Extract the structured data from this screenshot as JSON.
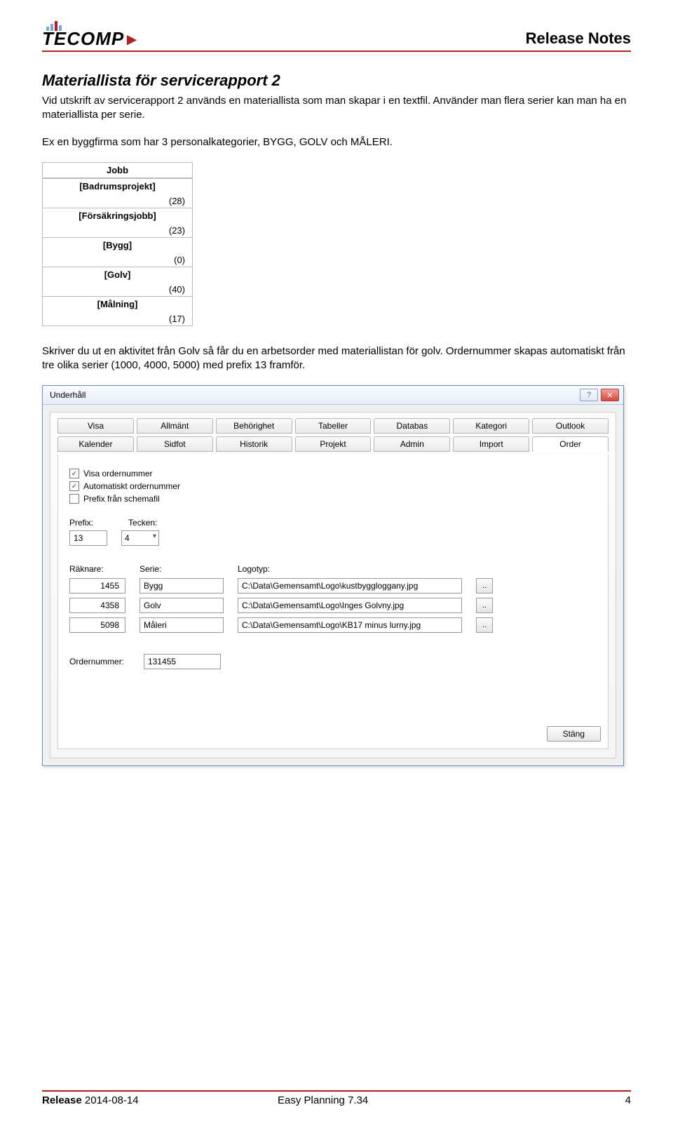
{
  "header": {
    "logo_text": "TECOMP",
    "doc_title": "Release Notes"
  },
  "section_title": "Materiallista för servicerapport 2",
  "para1": "Vid utskrift av servicerapport 2 används en materiallista som man skapar i en textfil. Använder man flera serier kan man ha en materiallista per serie.",
  "para2": "Ex en byggfirma som har 3 personalkategorier, BYGG, GOLV och MÅLERI.",
  "jobb": {
    "header": "Jobb",
    "rows": [
      {
        "label": "[Badrumsprojekt]",
        "count": "(28)"
      },
      {
        "label": "[Försäkringsjobb]",
        "count": "(23)"
      },
      {
        "label": "[Bygg]",
        "count": "(0)"
      },
      {
        "label": "[Golv]",
        "count": "(40)"
      },
      {
        "label": "[Målning]",
        "count": "(17)"
      }
    ]
  },
  "para3": "Skriver du ut en aktivitet från Golv så får du en arbetsorder med materiallistan för golv. Ordernummer skapas automatiskt från tre olika serier (1000, 4000, 5000) med prefix 13 framför.",
  "dialog": {
    "title": "Underhåll",
    "help_glyph": "?",
    "close_glyph": "✕",
    "tabs_top": [
      "Visa",
      "Allmänt",
      "Behörighet",
      "Tabeller",
      "Databas",
      "Kategori",
      "Outlook"
    ],
    "tabs_bottom": [
      "Kalender",
      "Sidfot",
      "Historik",
      "Projekt",
      "Admin",
      "Import",
      "Order"
    ],
    "active_tab": "Order",
    "checks": [
      {
        "label": "Visa ordernummer",
        "checked": true
      },
      {
        "label": "Automatiskt ordernummer",
        "checked": true
      },
      {
        "label": "Prefix från schemafil",
        "checked": false
      }
    ],
    "prefix_label": "Prefix:",
    "tecken_label": "Tecken:",
    "prefix_value": "13",
    "tecken_value": "4",
    "series_headers": {
      "c1": "Räknare:",
      "c2": "Serie:",
      "c3": "Logotyp:"
    },
    "series": [
      {
        "raknare": "1455",
        "serie": "Bygg",
        "logo": "C:\\Data\\Gemensamt\\Logo\\kustbyggloggany.jpg"
      },
      {
        "raknare": "4358",
        "serie": "Golv",
        "logo": "C:\\Data\\Gemensamt\\Logo\\Inges Golvny.jpg"
      },
      {
        "raknare": "5098",
        "serie": "Måleri",
        "logo": "C:\\Data\\Gemensamt\\Logo\\KB17 minus lurny.jpg"
      }
    ],
    "browse_label": "..",
    "ordernummer_label": "Ordernummer:",
    "ordernummer_value": "131455",
    "close_btn": "Stäng"
  },
  "footer": {
    "release_label": "Release",
    "release_date": "2014-08-14",
    "product": "Easy Planning 7.34",
    "page": "4"
  }
}
